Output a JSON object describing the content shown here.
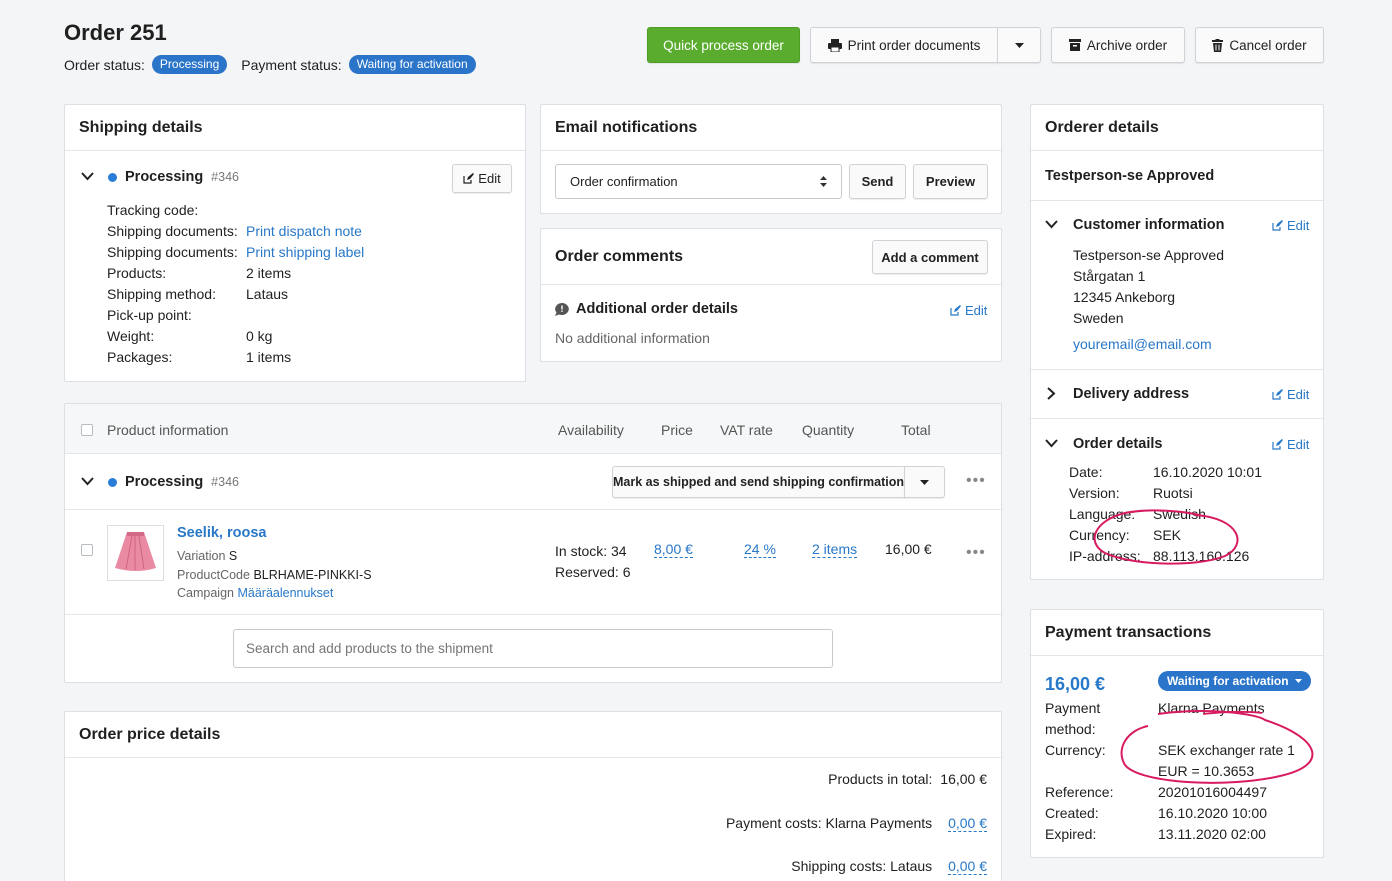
{
  "header": {
    "title": "Order 251",
    "order_status_label": "Order status:",
    "order_status": "Processing",
    "payment_status_label": "Payment status:",
    "payment_status": "Waiting for activation",
    "quick_process": "Quick process order",
    "print_docs": "Print order documents",
    "archive": "Archive order",
    "cancel": "Cancel order"
  },
  "shipping": {
    "title": "Shipping details",
    "status": "Processing",
    "number": "#346",
    "edit": "Edit",
    "rows": [
      {
        "label": "Tracking code:",
        "value": ""
      },
      {
        "label": "Shipping documents:",
        "value": "Print dispatch note",
        "link": true
      },
      {
        "label": "Shipping documents:",
        "value": "Print shipping label",
        "link": true
      },
      {
        "label": "Products:",
        "value": "2 items"
      },
      {
        "label": "Shipping method:",
        "value": "Lataus"
      },
      {
        "label": "Pick-up point:",
        "value": ""
      },
      {
        "label": "Weight:",
        "value": "0 kg"
      },
      {
        "label": "Packages:",
        "value": "1 items"
      }
    ]
  },
  "email": {
    "title": "Email notifications",
    "selected": "Order confirmation",
    "send": "Send",
    "preview": "Preview"
  },
  "comments": {
    "title": "Order comments",
    "add": "Add a comment",
    "additional_title": "Additional order details",
    "edit": "Edit",
    "empty": "No additional information"
  },
  "products": {
    "headers": {
      "product": "Product information",
      "availability": "Availability",
      "price": "Price",
      "vat": "VAT rate",
      "quantity": "Quantity",
      "total": "Total"
    },
    "shipment_status": "Processing",
    "shipment_number": "#346",
    "mark_shipped": "Mark as shipped and send shipping confirmation",
    "item": {
      "name": "Seelik, roosa",
      "variation_label": "Variation",
      "variation": "S",
      "code_label": "ProductCode",
      "code": "BLRHAME-PINKKI-S",
      "campaign_label": "Campaign",
      "campaign": "Määräalennukset",
      "in_stock": "In stock: 34",
      "reserved": "Reserved: 6",
      "price": "8,00 €",
      "vat": "24 %",
      "quantity": "2 items",
      "total": "16,00 €"
    },
    "search_placeholder": "Search and add products to the shipment"
  },
  "price_details": {
    "title": "Order price details",
    "products_total_label": "Products in total:",
    "products_total": "16,00 €",
    "payment_costs_label": "Payment costs: Klarna Payments",
    "payment_costs": "0,00 €",
    "shipping_costs_label": "Shipping costs: Lataus",
    "shipping_costs": "0,00 €"
  },
  "orderer": {
    "title": "Orderer details",
    "name": "Testperson-se Approved",
    "customer_title": "Customer information",
    "edit": "Edit",
    "address": [
      "Testperson-se Approved",
      "Stårgatan 1",
      "12345 Ankeborg",
      "Sweden"
    ],
    "email": "youremail@email.com",
    "delivery_title": "Delivery address",
    "order_details_title": "Order details",
    "details": [
      {
        "label": "Date:",
        "value": "16.10.2020 10:01"
      },
      {
        "label": "Version:",
        "value": "Ruotsi"
      },
      {
        "label": "Language:",
        "value": "Swedish"
      },
      {
        "label": "Currency:",
        "value": "SEK"
      },
      {
        "label": "IP-address:",
        "value": "88.113.160.126"
      }
    ]
  },
  "payment": {
    "title": "Payment transactions",
    "amount": "16,00 €",
    "status": "Waiting for activation",
    "method_label_1": "Payment",
    "method_label_2": "method:",
    "method": "Klarna Payments",
    "currency_label": "Currency:",
    "currency_1": "SEK exchanger rate 1",
    "currency_2": "EUR = 10.3653",
    "reference_label": "Reference:",
    "reference": "20201016004497",
    "created_label": "Created:",
    "created": "16.10.2020 10:00",
    "expired_label": "Expired:",
    "expired": "13.11.2020 02:00"
  },
  "colors": {
    "accent": "#2a74c9",
    "green": "#5aac2e",
    "annotation": "#d81b60"
  }
}
